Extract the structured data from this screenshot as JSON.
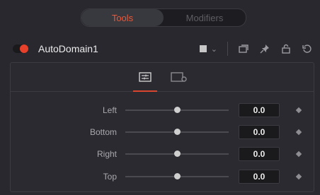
{
  "tabs": [
    {
      "label": "Tools",
      "active": true
    },
    {
      "label": "Modifiers",
      "active": false
    }
  ],
  "node": {
    "name": "AutoDomain1",
    "enabled": true,
    "color_swatch": "#c7c7c7"
  },
  "header_icons": [
    "color-swatch-icon",
    "chevron-down-icon",
    "collapse-icon",
    "pin-icon",
    "lock-icon",
    "reset-icon"
  ],
  "panel_tabs": [
    {
      "icon": "controls-icon",
      "active": true
    },
    {
      "icon": "settings-icon",
      "active": false
    }
  ],
  "controls": [
    {
      "label": "Left",
      "value": "0.0",
      "slider_position": 0.5
    },
    {
      "label": "Bottom",
      "value": "0.0",
      "slider_position": 0.5
    },
    {
      "label": "Right",
      "value": "0.0",
      "slider_position": 0.5
    },
    {
      "label": "Top",
      "value": "0.0",
      "slider_position": 0.5
    }
  ],
  "colors": {
    "accent": "#e8412b",
    "background": "#28282e"
  }
}
